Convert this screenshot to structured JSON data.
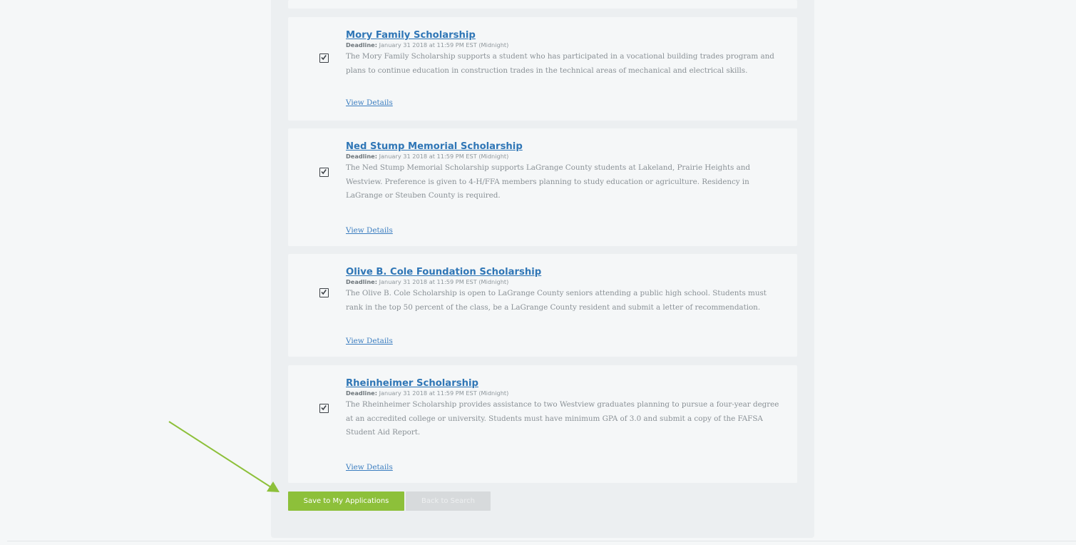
{
  "scholarships": [
    {
      "title": "Mory Family Scholarship",
      "deadline_label": "Deadline:",
      "deadline_value": "January 31 2018 at 11:59 PM EST (Midnight)",
      "description": "The Mory Family Scholarship supports a student who has participated in a vocational building trades program and plans to continue education in construction trades in the technical areas of mechanical and electrical skills.",
      "details_link": "View Details",
      "checked": true
    },
    {
      "title": "Ned Stump Memorial Scholarship",
      "deadline_label": "Deadline:",
      "deadline_value": "January 31 2018 at 11:59 PM EST (Midnight)",
      "description": "The Ned Stump Memorial Scholarship supports LaGrange County students at Lakeland, Prairie Heights and Westview. Preference is given to 4-H/FFA members planning to study education or agriculture. Residency in LaGrange or Steuben County is required.",
      "details_link": "View Details",
      "checked": true
    },
    {
      "title": "Olive B. Cole Foundation Scholarship",
      "deadline_label": "Deadline:",
      "deadline_value": "January 31 2018 at 11:59 PM EST (Midnight)",
      "description": "The Olive B. Cole Scholarship is open to LaGrange County seniors attending a public high school. Students must rank in the top 50 percent of the class, be a LaGrange County resident and submit a letter of recommendation.",
      "details_link": "View Details",
      "checked": true
    },
    {
      "title": "Rheinheimer Scholarship",
      "deadline_label": "Deadline:",
      "deadline_value": "January 31 2018 at 11:59 PM EST (Midnight)",
      "description": "The Rheinheimer Scholarship provides assistance to two Westview graduates planning to pursue a four-year degree at an accredited college or university. Students must have minimum GPA of 3.0 and submit a copy of the FAFSA Student Aid Report.",
      "details_link": "View Details",
      "checked": true
    }
  ],
  "actions": {
    "save_label": "Save to My Applications",
    "back_label": "Back to Search"
  },
  "colors": {
    "link": "#2f76b6",
    "save_button": "#8dc03a",
    "back_button": "#d7dadc",
    "annotation_arrow": "#8dc03a"
  },
  "annotation": {
    "icon": "arrow-pointer-icon"
  }
}
